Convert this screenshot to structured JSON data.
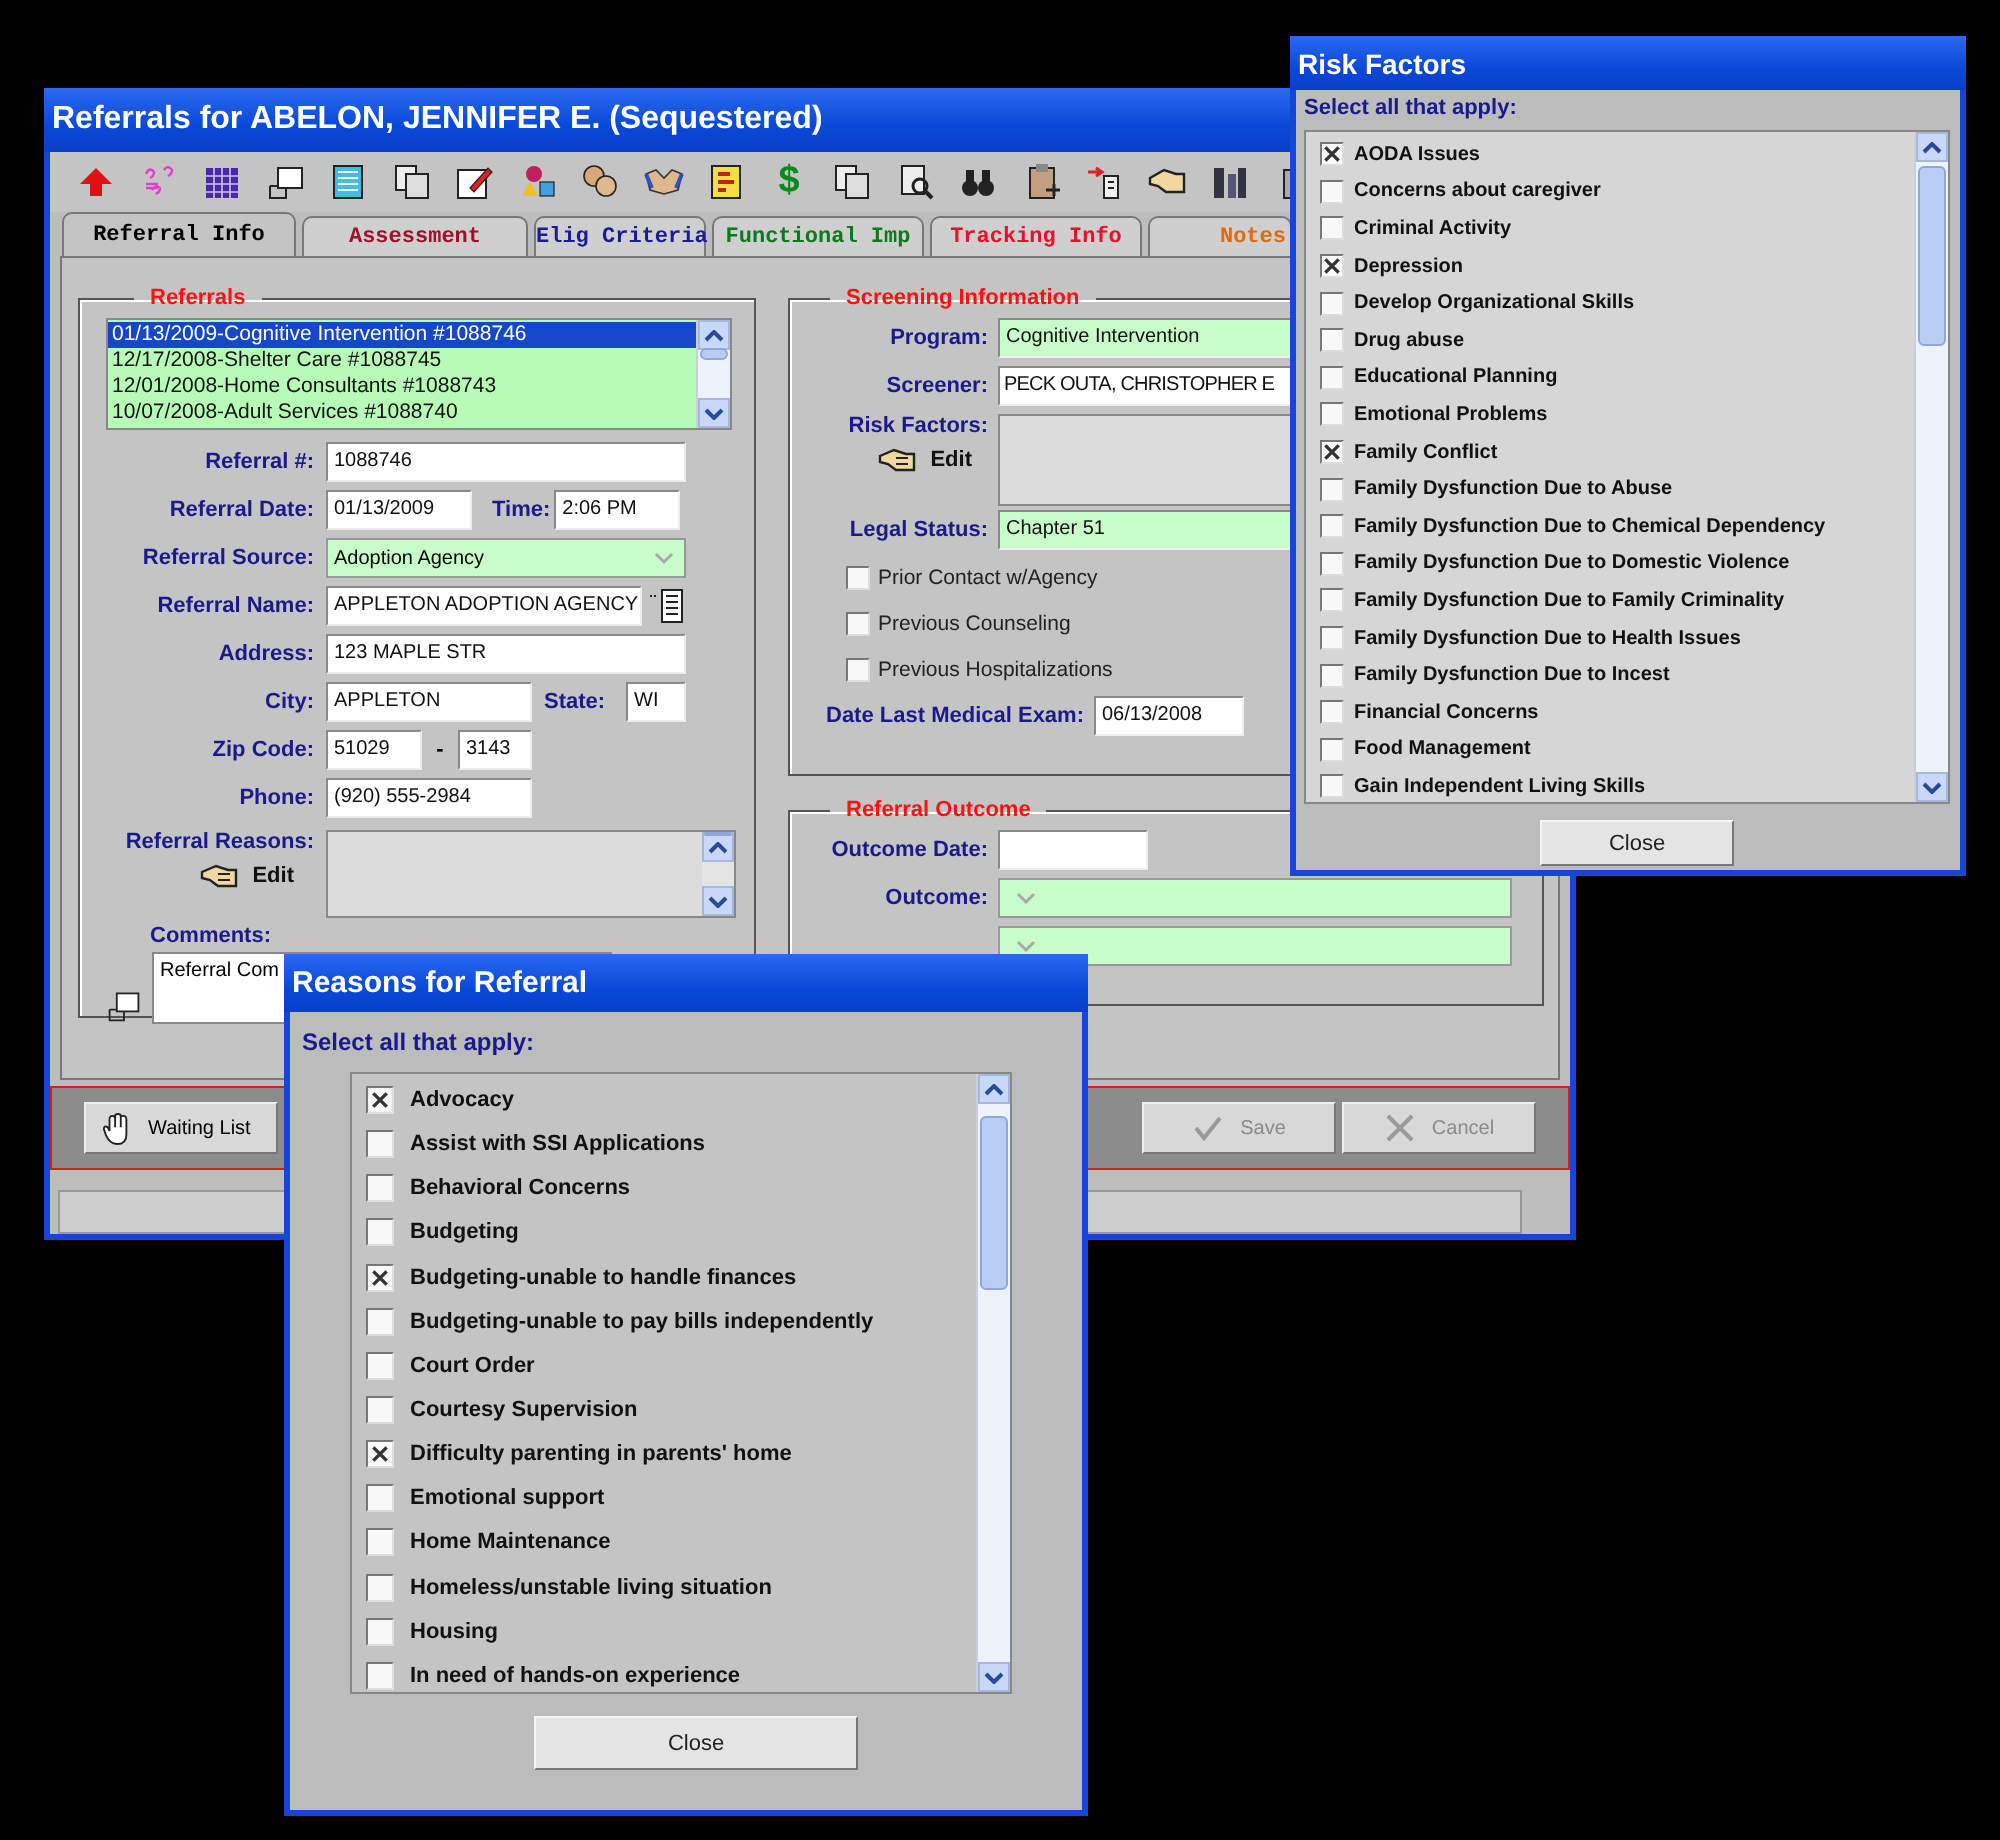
{
  "main_window": {
    "title": "Referrals for ABELON, JENNIFER E. (Sequestered)",
    "toolbar": {
      "currency_button": "$"
    },
    "tabs": [
      {
        "label": "Referral Info",
        "selected": true,
        "color": "#000000"
      },
      {
        "label": "Assessment",
        "selected": false,
        "color": "#a0102a"
      },
      {
        "label": "Elig Criteria",
        "selected": false,
        "color": "#1a1a9a"
      },
      {
        "label": "Functional Imp",
        "selected": false,
        "color": "#0a7a1a"
      },
      {
        "label": "Tracking Info",
        "selected": false,
        "color": "#e8102a"
      },
      {
        "label": "Notes",
        "selected": false,
        "color": "#e06a10"
      }
    ],
    "referrals": {
      "title": "Referrals",
      "items": [
        {
          "text": "01/13/2009-Cognitive Intervention #1088746",
          "selected": true
        },
        {
          "text": "12/17/2008-Shelter Care #1088745",
          "selected": false
        },
        {
          "text": "12/01/2008-Home Consultants #1088743",
          "selected": false
        },
        {
          "text": "10/07/2008-Adult Services #1088740",
          "selected": false
        }
      ],
      "referral_number": {
        "label": "Referral #:",
        "value": "1088746"
      },
      "referral_date": {
        "label": "Referral Date:",
        "value": "01/13/2009"
      },
      "time": {
        "label": "Time:",
        "value": "2:06 PM"
      },
      "referral_source": {
        "label": "Referral Source:",
        "value": "Adoption Agency"
      },
      "referral_name": {
        "label": "Referral Name:",
        "value": "APPLETON ADOPTION AGENCY"
      },
      "address": {
        "label": "Address:",
        "value": "123 MAPLE STR"
      },
      "city": {
        "label": "City:",
        "value": "APPLETON"
      },
      "state": {
        "label": "State:",
        "value": "WI"
      },
      "zip_code": {
        "label": "Zip Code:",
        "value": "51029",
        "separator": "-",
        "suffix": "3143"
      },
      "phone": {
        "label": "Phone:",
        "value": "(920) 555-2984"
      },
      "referral_reasons": {
        "label": "Referral Reasons:",
        "edit": "Edit"
      },
      "comments": {
        "label": "Comments:",
        "value": "Referral Com"
      }
    },
    "screening": {
      "title": "Screening Information",
      "program": {
        "label": "Program:",
        "value": "Cognitive Intervention"
      },
      "screener": {
        "label": "Screener:",
        "value": "PECK OUTA, CHRISTOPHER E"
      },
      "risk_factors": {
        "label": "Risk Factors:",
        "edit": "Edit"
      },
      "legal_status": {
        "label": "Legal Status:",
        "value": "Chapter 51"
      },
      "checkboxes": [
        {
          "label": "Prior Contact w/Agency",
          "checked": false
        },
        {
          "label": "Previous Counseling",
          "checked": false
        },
        {
          "label": "Previous Hospitalizations",
          "checked": false
        }
      ],
      "date_last_medical_exam": {
        "label": "Date Last Medical Exam:",
        "value": "06/13/2008"
      }
    },
    "outcome": {
      "title": "Referral Outcome",
      "outcome_date": {
        "label": "Outcome Date:"
      },
      "outcome": {
        "label": "Outcome:"
      }
    },
    "actions": {
      "waiting_list": "Waiting List",
      "save": {
        "label": "Save",
        "disabled": true
      },
      "cancel": {
        "label": "Cancel",
        "disabled": true
      }
    }
  },
  "risk_factors_dialog": {
    "title": "Risk Factors",
    "prompt": "Select all that apply:",
    "close": "Close",
    "items": [
      {
        "label": "AODA Issues",
        "checked": true
      },
      {
        "label": "Concerns about caregiver",
        "checked": false
      },
      {
        "label": "Criminal Activity",
        "checked": false
      },
      {
        "label": "Depression",
        "checked": true
      },
      {
        "label": "Develop Organizational Skills",
        "checked": false
      },
      {
        "label": "Drug abuse",
        "checked": false
      },
      {
        "label": "Educational Planning",
        "checked": false
      },
      {
        "label": "Emotional Problems",
        "checked": false
      },
      {
        "label": "Family Conflict",
        "checked": true
      },
      {
        "label": "Family Dysfunction Due to Abuse",
        "checked": false
      },
      {
        "label": "Family Dysfunction Due to Chemical Dependency",
        "checked": false
      },
      {
        "label": "Family Dysfunction Due to Domestic Violence",
        "checked": false
      },
      {
        "label": "Family Dysfunction Due to Family Criminality",
        "checked": false
      },
      {
        "label": "Family Dysfunction Due to Health Issues",
        "checked": false
      },
      {
        "label": "Family Dysfunction Due to Incest",
        "checked": false
      },
      {
        "label": "Financial Concerns",
        "checked": false
      },
      {
        "label": "Food Management",
        "checked": false
      },
      {
        "label": "Gain Independent Living Skills",
        "checked": false
      }
    ]
  },
  "reasons_dialog": {
    "title": "Reasons for Referral",
    "prompt": "Select all that apply:",
    "close": "Close",
    "items": [
      {
        "label": "Advocacy",
        "checked": true
      },
      {
        "label": "Assist with SSI Applications",
        "checked": false
      },
      {
        "label": "Behavioral Concerns",
        "checked": false
      },
      {
        "label": "Budgeting",
        "checked": false
      },
      {
        "label": "Budgeting-unable to handle finances",
        "checked": true
      },
      {
        "label": "Budgeting-unable to pay bills independently",
        "checked": false
      },
      {
        "label": "Court Order",
        "checked": false
      },
      {
        "label": "Courtesy Supervision",
        "checked": false
      },
      {
        "label": "Difficulty parenting in parents' home",
        "checked": true
      },
      {
        "label": "Emotional support",
        "checked": false
      },
      {
        "label": "Home Maintenance",
        "checked": false
      },
      {
        "label": "Homeless/unstable living situation",
        "checked": false
      },
      {
        "label": "Housing",
        "checked": false
      },
      {
        "label": "In need of hands-on experience",
        "checked": false
      }
    ]
  }
}
